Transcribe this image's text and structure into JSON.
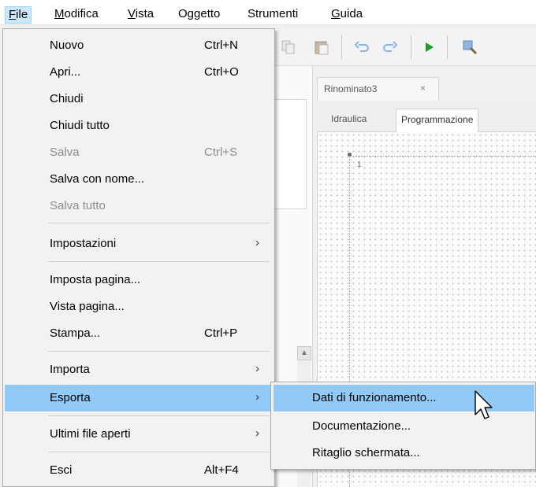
{
  "menubar": {
    "items": [
      {
        "label": "File",
        "mnemonic": "F",
        "rest": "ile",
        "active": true
      },
      {
        "label": "Modifica",
        "mnemonic": "M",
        "rest": "odifica"
      },
      {
        "label": "Vista",
        "mnemonic": "V",
        "rest": "ista"
      },
      {
        "label": "Oggetto"
      },
      {
        "label": "Strumenti"
      },
      {
        "label": "Guida",
        "mnemonic": "G",
        "rest": "uida"
      }
    ]
  },
  "file_menu": {
    "items": [
      {
        "label": "Nuovo",
        "shortcut": "Ctrl+N"
      },
      {
        "label": "Apri...",
        "shortcut": "Ctrl+O"
      },
      {
        "label": "Chiudi"
      },
      {
        "label": "Chiudi tutto"
      },
      {
        "label": "Salva",
        "shortcut": "Ctrl+S",
        "disabled": true
      },
      {
        "label": "Salva con nome..."
      },
      {
        "label": "Salva tutto",
        "disabled": true
      },
      {
        "label": "Impostazioni",
        "submenu": "›"
      },
      {
        "label": "Imposta pagina..."
      },
      {
        "label": "Vista pagina..."
      },
      {
        "label": "Stampa...",
        "shortcut": "Ctrl+P"
      },
      {
        "label": "Importa",
        "submenu": "›"
      },
      {
        "label": "Esporta",
        "submenu": "›",
        "highlighted": true
      },
      {
        "label": "Ultimi file aperti",
        "submenu": "›"
      },
      {
        "label": "Esci",
        "shortcut": "Alt+F4"
      }
    ]
  },
  "export_submenu": {
    "items": [
      {
        "label": "Dati di funzionamento...",
        "highlighted": true
      },
      {
        "label": "Documentazione..."
      },
      {
        "label": "Ritaglio schermata..."
      }
    ]
  },
  "document": {
    "tab_title": "Rinominato3",
    "tab_close": "×",
    "subtabs": [
      "Idraulica",
      "Programmazione"
    ],
    "selected_subtab": "Programmazione",
    "row_number": "1"
  },
  "toolbar_icons": [
    "copy-icon",
    "paste-icon",
    "undo-icon",
    "redo-icon",
    "run-icon",
    "zoom-icon"
  ],
  "colors": {
    "highlight": "#91c9f7",
    "menu_background": "#f2f2f2",
    "disabled_text": "#8d8d8d",
    "run_green": "#1d9a2a"
  }
}
